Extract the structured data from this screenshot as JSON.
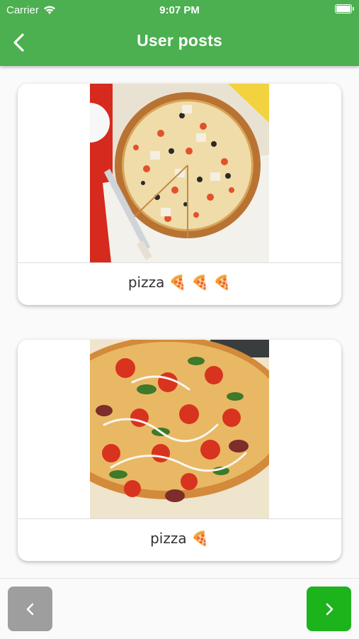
{
  "status_bar": {
    "carrier": "Carrier",
    "time": "9:07 PM"
  },
  "header": {
    "title": "User posts",
    "back_icon": "chevron-left-icon"
  },
  "posts": [
    {
      "caption": "pizza 🍕 🍕 🍕",
      "image": "pizza-photo-veggie"
    },
    {
      "caption": "pizza 🍕",
      "image": "pizza-photo-tomato-spinach"
    }
  ],
  "navigation": {
    "prev_icon": "chevron-left-icon",
    "next_icon": "chevron-right-icon"
  },
  "colors": {
    "header": "#4caf50",
    "next_button": "#1db31d",
    "prev_button": "#9e9e9e"
  }
}
